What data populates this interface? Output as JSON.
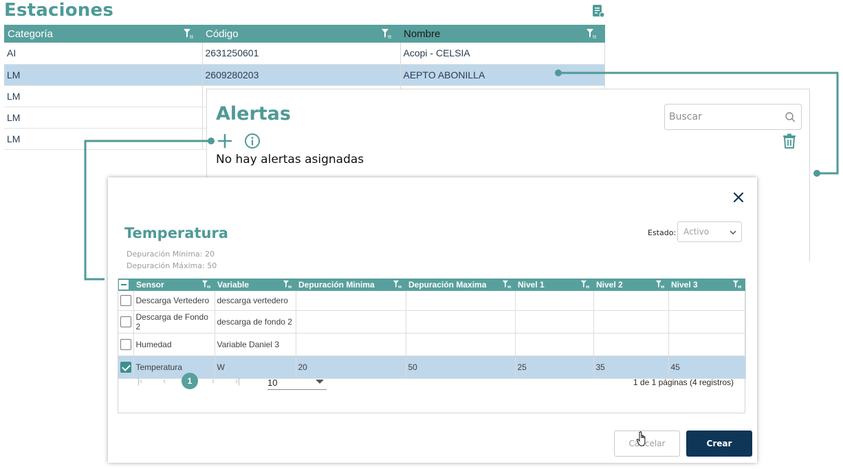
{
  "estaciones": {
    "title": "Estaciones",
    "columns": [
      "Categoría",
      "Código",
      "Nombre"
    ],
    "rows": [
      {
        "categoria": "AI",
        "codigo": "2631250601",
        "nombre": "Acopi - CELSIA"
      },
      {
        "categoria": "LM",
        "codigo": "2609280203",
        "nombre": "AEPTO ABONILLA"
      },
      {
        "categoria": "LM",
        "codigo": "",
        "nombre": ""
      },
      {
        "categoria": "LM",
        "codigo": "",
        "nombre": ""
      },
      {
        "categoria": "LM",
        "codigo": "",
        "nombre": ""
      }
    ],
    "selected_row": 1
  },
  "alertas": {
    "title": "Alertas",
    "search_placeholder": "Buscar",
    "empty_message": "No hay alertas asignadas"
  },
  "modal": {
    "title": "Temperatura",
    "dep_min": "Depuración Mínima: 20",
    "dep_max": "Depuración Máxima: 50",
    "estado_label": "Estado:",
    "estado_value": "Activo",
    "columns": [
      "Sensor",
      "Variable",
      "Depuración Minima",
      "Depuración Maxima",
      "Nivel 1",
      "Nivel 2",
      "Nivel 3"
    ],
    "rows": [
      {
        "sensor": "Descarga Vertedero",
        "variable": "descarga vertedero",
        "dep_min": "",
        "dep_max": "",
        "n1": "",
        "n2": "",
        "n3": "",
        "checked": false
      },
      {
        "sensor": "Descarga de Fondo 2",
        "variable": "descarga de fondo 2",
        "dep_min": "",
        "dep_max": "",
        "n1": "",
        "n2": "",
        "n3": "",
        "checked": false
      },
      {
        "sensor": "Humedad",
        "variable": "Variable Daniel 3",
        "dep_min": "",
        "dep_max": "",
        "n1": "",
        "n2": "",
        "n3": "",
        "checked": false
      },
      {
        "sensor": "Temperatura",
        "variable": "W",
        "dep_min": "20",
        "dep_max": "50",
        "n1": "25",
        "n2": "35",
        "n3": "45",
        "checked": true
      }
    ],
    "pager": {
      "current_page": "1",
      "page_size": "10",
      "info": "1 de 1 páginas (4 registros)"
    },
    "cancel_label": "Cancelar",
    "create_label": "Crear"
  },
  "colors": {
    "accent": "#58a09d",
    "selection": "#bfd7ea",
    "primary_button": "#0f3557"
  }
}
